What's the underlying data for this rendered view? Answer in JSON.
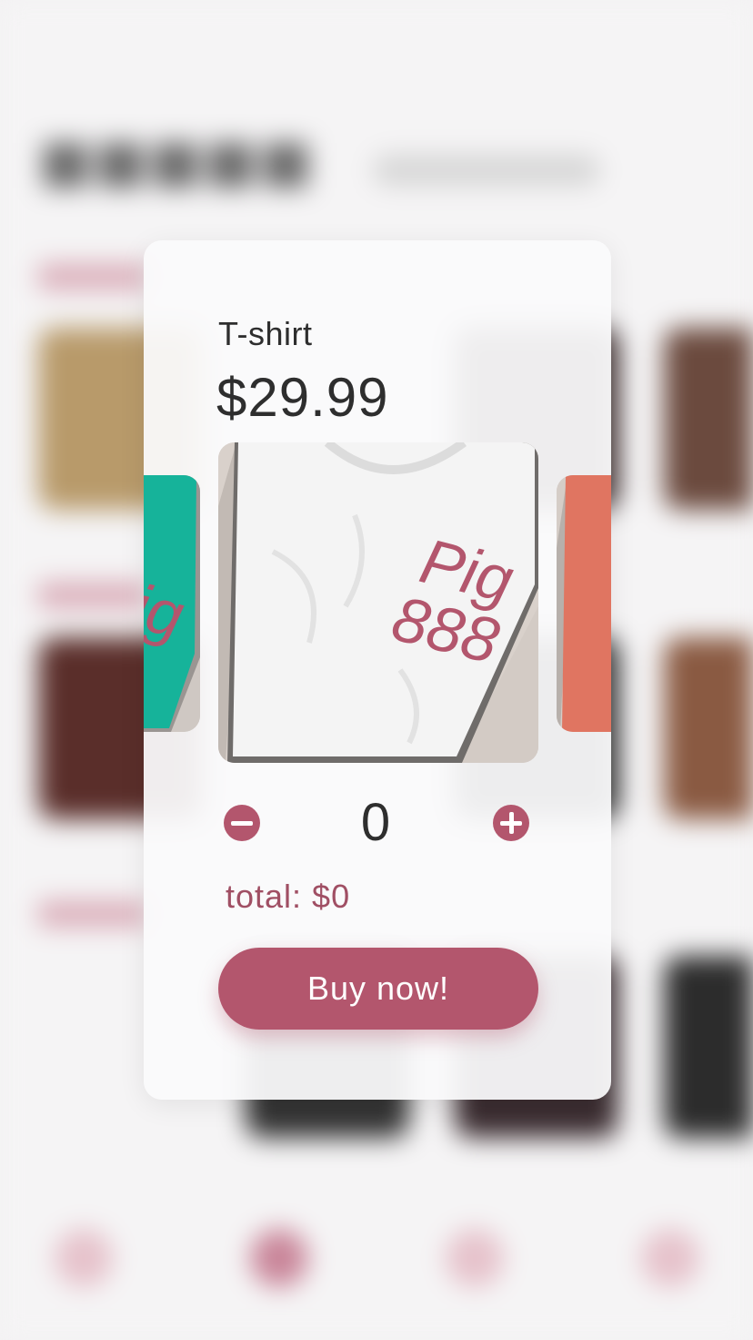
{
  "modal": {
    "product_name": "T-shirt",
    "price": "$29.99",
    "quantity": "0",
    "total": "total: $0",
    "buy_label": "Buy now!"
  },
  "carousel": {
    "items": [
      {
        "name": "green-tshirt",
        "color": "#16b39a",
        "print_text": "Pig"
      },
      {
        "name": "white-tshirt",
        "color": "#f2f2f2",
        "print_text": "Pig 888"
      },
      {
        "name": "coral-tshirt",
        "color": "#e07561",
        "print_text": ""
      }
    ],
    "selected_index": 1
  },
  "colors": {
    "accent": "#b3566d",
    "text": "#2e2e2e",
    "total_text": "#a04f64"
  },
  "icons": {
    "decrease": "minus-circle-icon",
    "increase": "plus-circle-icon"
  }
}
